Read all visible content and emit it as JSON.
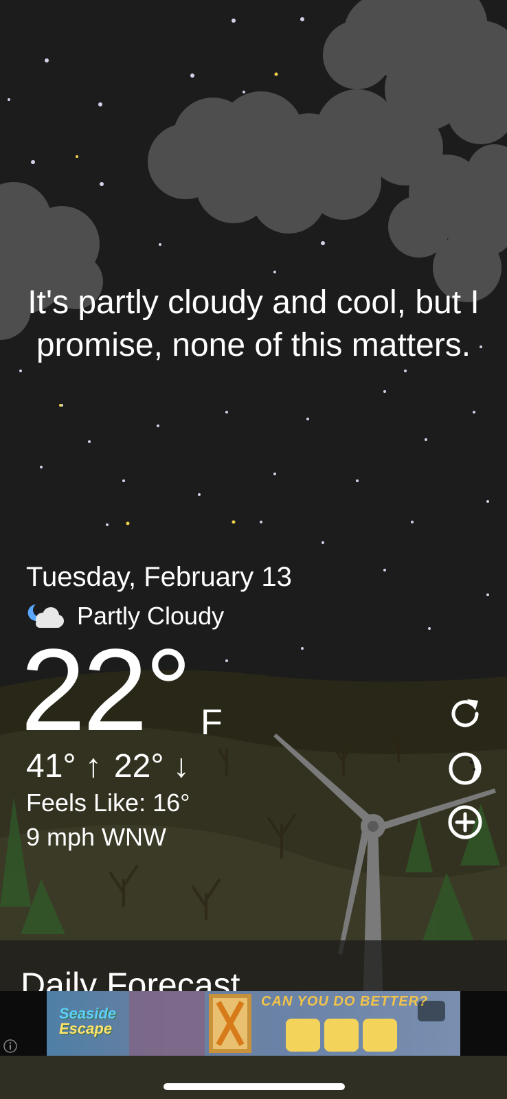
{
  "weather": {
    "quote": "It's partly cloudy and cool, but I promise, none of this matters.",
    "date": "Tuesday, February 13",
    "condition": "Partly Cloudy",
    "condition_icon": "partly-cloudy-night-icon",
    "temperature": "22°",
    "unit": "F",
    "high": "41° ↑",
    "low": "22° ↓",
    "feels_like": "Feels Like: 16°",
    "wind": "9 mph WNW"
  },
  "actions": {
    "refresh_icon": "refresh-icon",
    "moon_icon": "moon-phase-icon",
    "add_icon": "add-location-icon"
  },
  "forecast": {
    "title": "Daily Forecast"
  },
  "ad": {
    "headline": "CAN YOU DO BETTER?",
    "brand_line1": "Seaside",
    "brand_line2": "Escape",
    "info_icon": "info-icon"
  },
  "colors": {
    "sky": "#1c1c1c",
    "ground": "#302f24",
    "ad_accent": "#f2c34a"
  }
}
